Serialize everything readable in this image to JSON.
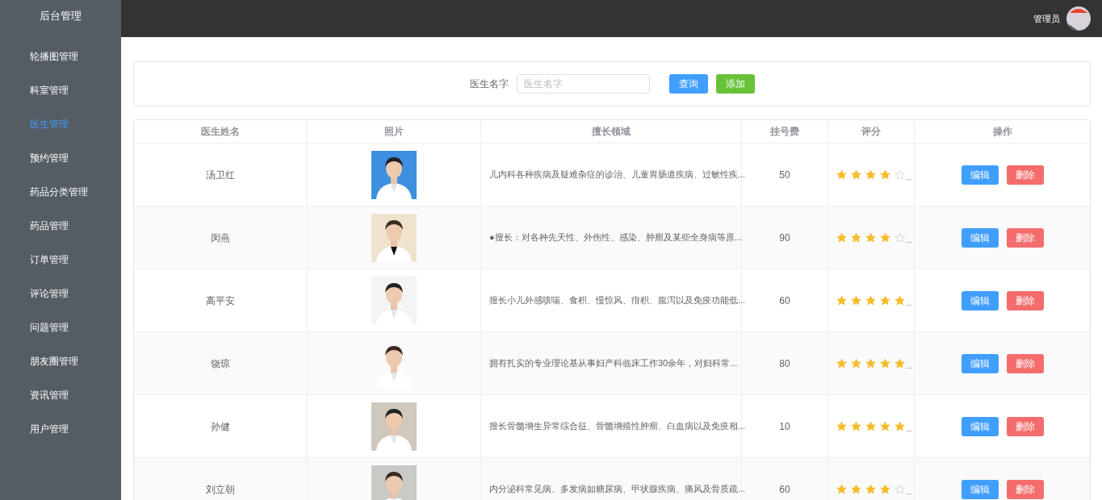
{
  "sidebar": {
    "title": "后台管理",
    "items": [
      {
        "label": "轮播图管理",
        "selected": false
      },
      {
        "label": "科室管理",
        "selected": false
      },
      {
        "label": "医生管理",
        "selected": true
      },
      {
        "label": "预约管理",
        "selected": false
      },
      {
        "label": "药品分类管理",
        "selected": false
      },
      {
        "label": "药品管理",
        "selected": false
      },
      {
        "label": "订单管理",
        "selected": false
      },
      {
        "label": "评论管理",
        "selected": false
      },
      {
        "label": "问题管理",
        "selected": false
      },
      {
        "label": "朋友圈管理",
        "selected": false
      },
      {
        "label": "资讯管理",
        "selected": false
      },
      {
        "label": "用户管理",
        "selected": false
      }
    ]
  },
  "header": {
    "user": "管理员"
  },
  "search": {
    "label": "医生名字",
    "placeholder": "医生名字",
    "buttons": [
      "查询",
      "添加"
    ]
  },
  "table": {
    "columns": [
      "医生姓名",
      "照片",
      "擅长领域",
      "挂号费",
      "评分",
      "操作"
    ],
    "rows": [
      {
        "name": "汤卫红",
        "specialty": "儿内科各种疾病及疑难杂症的诊治、儿童胃肠道疾病、过敏性疾...",
        "fee": "50",
        "stars": 4,
        "rating_more": "...",
        "actions": [
          "编辑",
          "删除"
        ]
      },
      {
        "name": "闵燕",
        "specialty": "●擅长：对各种先天性、外伤性、感染、肿瘤及某些全身病等原...",
        "fee": "90",
        "stars": 4,
        "rating_more": "...",
        "actions": [
          "编辑",
          "删除"
        ]
      },
      {
        "name": "高平安",
        "specialty": "擅长小儿外感咳喘、食积、慢惊风、疳积、腹泻以及免疫功能低...",
        "fee": "60",
        "stars": 5,
        "rating_more": "...",
        "actions": [
          "编辑",
          "删除"
        ]
      },
      {
        "name": "饶琼",
        "specialty": "拥有扎实的专业理论基从事妇产科临床工作30余年，对妇科常...",
        "fee": "80",
        "stars": 5,
        "rating_more": "...",
        "actions": [
          "编辑",
          "删除"
        ]
      },
      {
        "name": "孙健",
        "specialty": "擅长骨髓增生异常综合征、骨髓增殖性肿瘤、白血病以及免疫相...",
        "fee": "10",
        "stars": 5,
        "rating_more": "...",
        "actions": [
          "编辑",
          "删除"
        ]
      },
      {
        "name": "刘立朝",
        "specialty": "内分泌科常见病、多发病如糖尿病、甲状腺疾病、痛风及骨质疏...",
        "fee": "60",
        "stars": 4,
        "rating_more": "...",
        "actions": [
          "编辑",
          "删除"
        ]
      }
    ]
  }
}
